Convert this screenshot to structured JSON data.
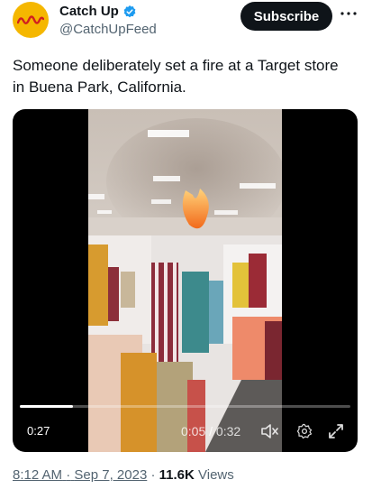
{
  "author": {
    "name": "Catch Up",
    "handle": "@CatchUpFeed",
    "verified_icon": "verified-badge-icon",
    "avatar_color": "#f5b700"
  },
  "actions": {
    "subscribe_label": "Subscribe",
    "more_icon": "more-icon"
  },
  "tweet": {
    "text_line1": "Someone deliberately set a fire at a Target store",
    "text_line2": "in Buena Park, California."
  },
  "video": {
    "elapsed_badge": "0:27",
    "time_display": "0:05 / 0:32",
    "progress_fraction": 0.16,
    "icons": [
      "mute-icon",
      "settings-icon",
      "fullscreen-icon"
    ]
  },
  "meta": {
    "time": "8:12 AM",
    "separator": "·",
    "date": "Sep 7, 2023",
    "views_count": "11.6K",
    "views_label": "Views"
  },
  "colors": {
    "accent": "#1d9bf0",
    "text": "#0f1419",
    "secondary": "#536471"
  }
}
